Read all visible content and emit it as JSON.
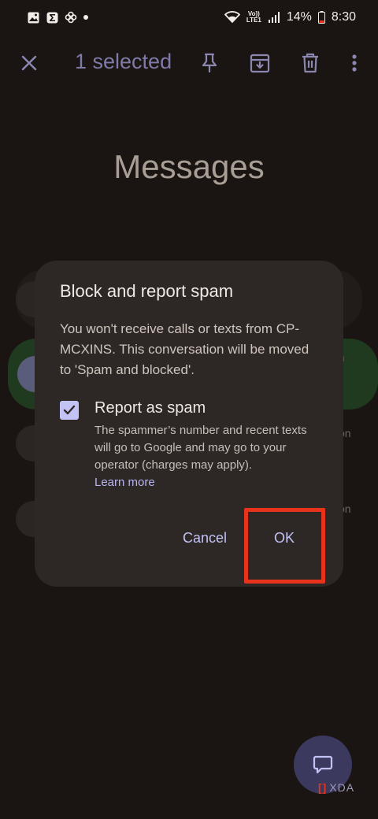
{
  "status_bar": {
    "battery": "14%",
    "time": "8:30",
    "volte": "Vo))",
    "lte": "LTE1"
  },
  "app_bar": {
    "selected_count_label": "1 selected"
  },
  "page": {
    "title": "Messages"
  },
  "background_rows": [
    {
      "trailing_text": "m"
    },
    {
      "trailing_text": "on"
    },
    {
      "trailing_text": "on"
    }
  ],
  "dialog": {
    "title": "Block and report spam",
    "body": "You won't receive calls or texts from CP-MCXINS. This conversation will be moved to 'Spam and blocked'.",
    "checkbox": {
      "checked": true,
      "label": "Report as spam",
      "description": "The spammer’s number and recent texts will go to Google and may go to your operator (charges may apply).",
      "learn_more": "Learn more"
    },
    "cancel_label": "Cancel",
    "ok_label": "OK"
  },
  "watermark": {
    "text": "XDA"
  },
  "colors": {
    "background": "#1a1512",
    "dialog": "#2d2826",
    "accent": "#c3c2f5",
    "highlight": "#e8331c"
  }
}
